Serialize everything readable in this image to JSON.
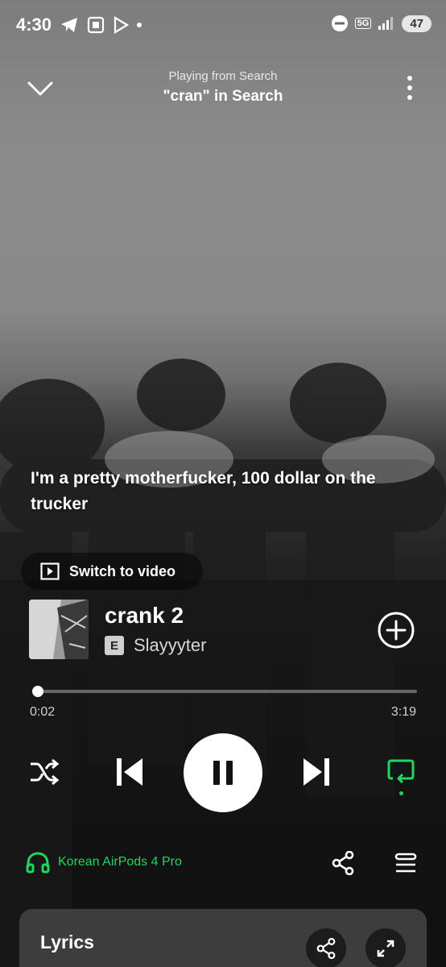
{
  "status_bar": {
    "time": "4:30",
    "network": "5G",
    "battery": "47"
  },
  "header": {
    "context_label": "Playing from Search",
    "context_title": "\"cran\" in Search"
  },
  "lyric_overlay": {
    "line": "I'm a pretty motherfucker, 100 dollar on the trucker"
  },
  "switch_video": {
    "label": "Switch to video"
  },
  "track": {
    "title": "crank 2",
    "explicit_badge": "E",
    "artist": "Slayyyter"
  },
  "playback": {
    "elapsed": "0:02",
    "duration": "3:19",
    "progress_fraction": 0.01,
    "is_playing": true,
    "repeat_active": true
  },
  "device": {
    "name": "Korean AirPods 4 Pro"
  },
  "lyrics_card": {
    "heading": "Lyrics"
  },
  "colors": {
    "accent_green": "#1ed760",
    "card_bg": "#3d3d3d"
  },
  "icons": [
    "chevron-down-icon",
    "more-vertical-icon",
    "play-video-icon",
    "add-circle-icon",
    "shuffle-icon",
    "skip-previous-icon",
    "pause-icon",
    "skip-next-icon",
    "repeat-icon",
    "headphones-icon",
    "share-icon",
    "queue-icon",
    "expand-icon"
  ]
}
